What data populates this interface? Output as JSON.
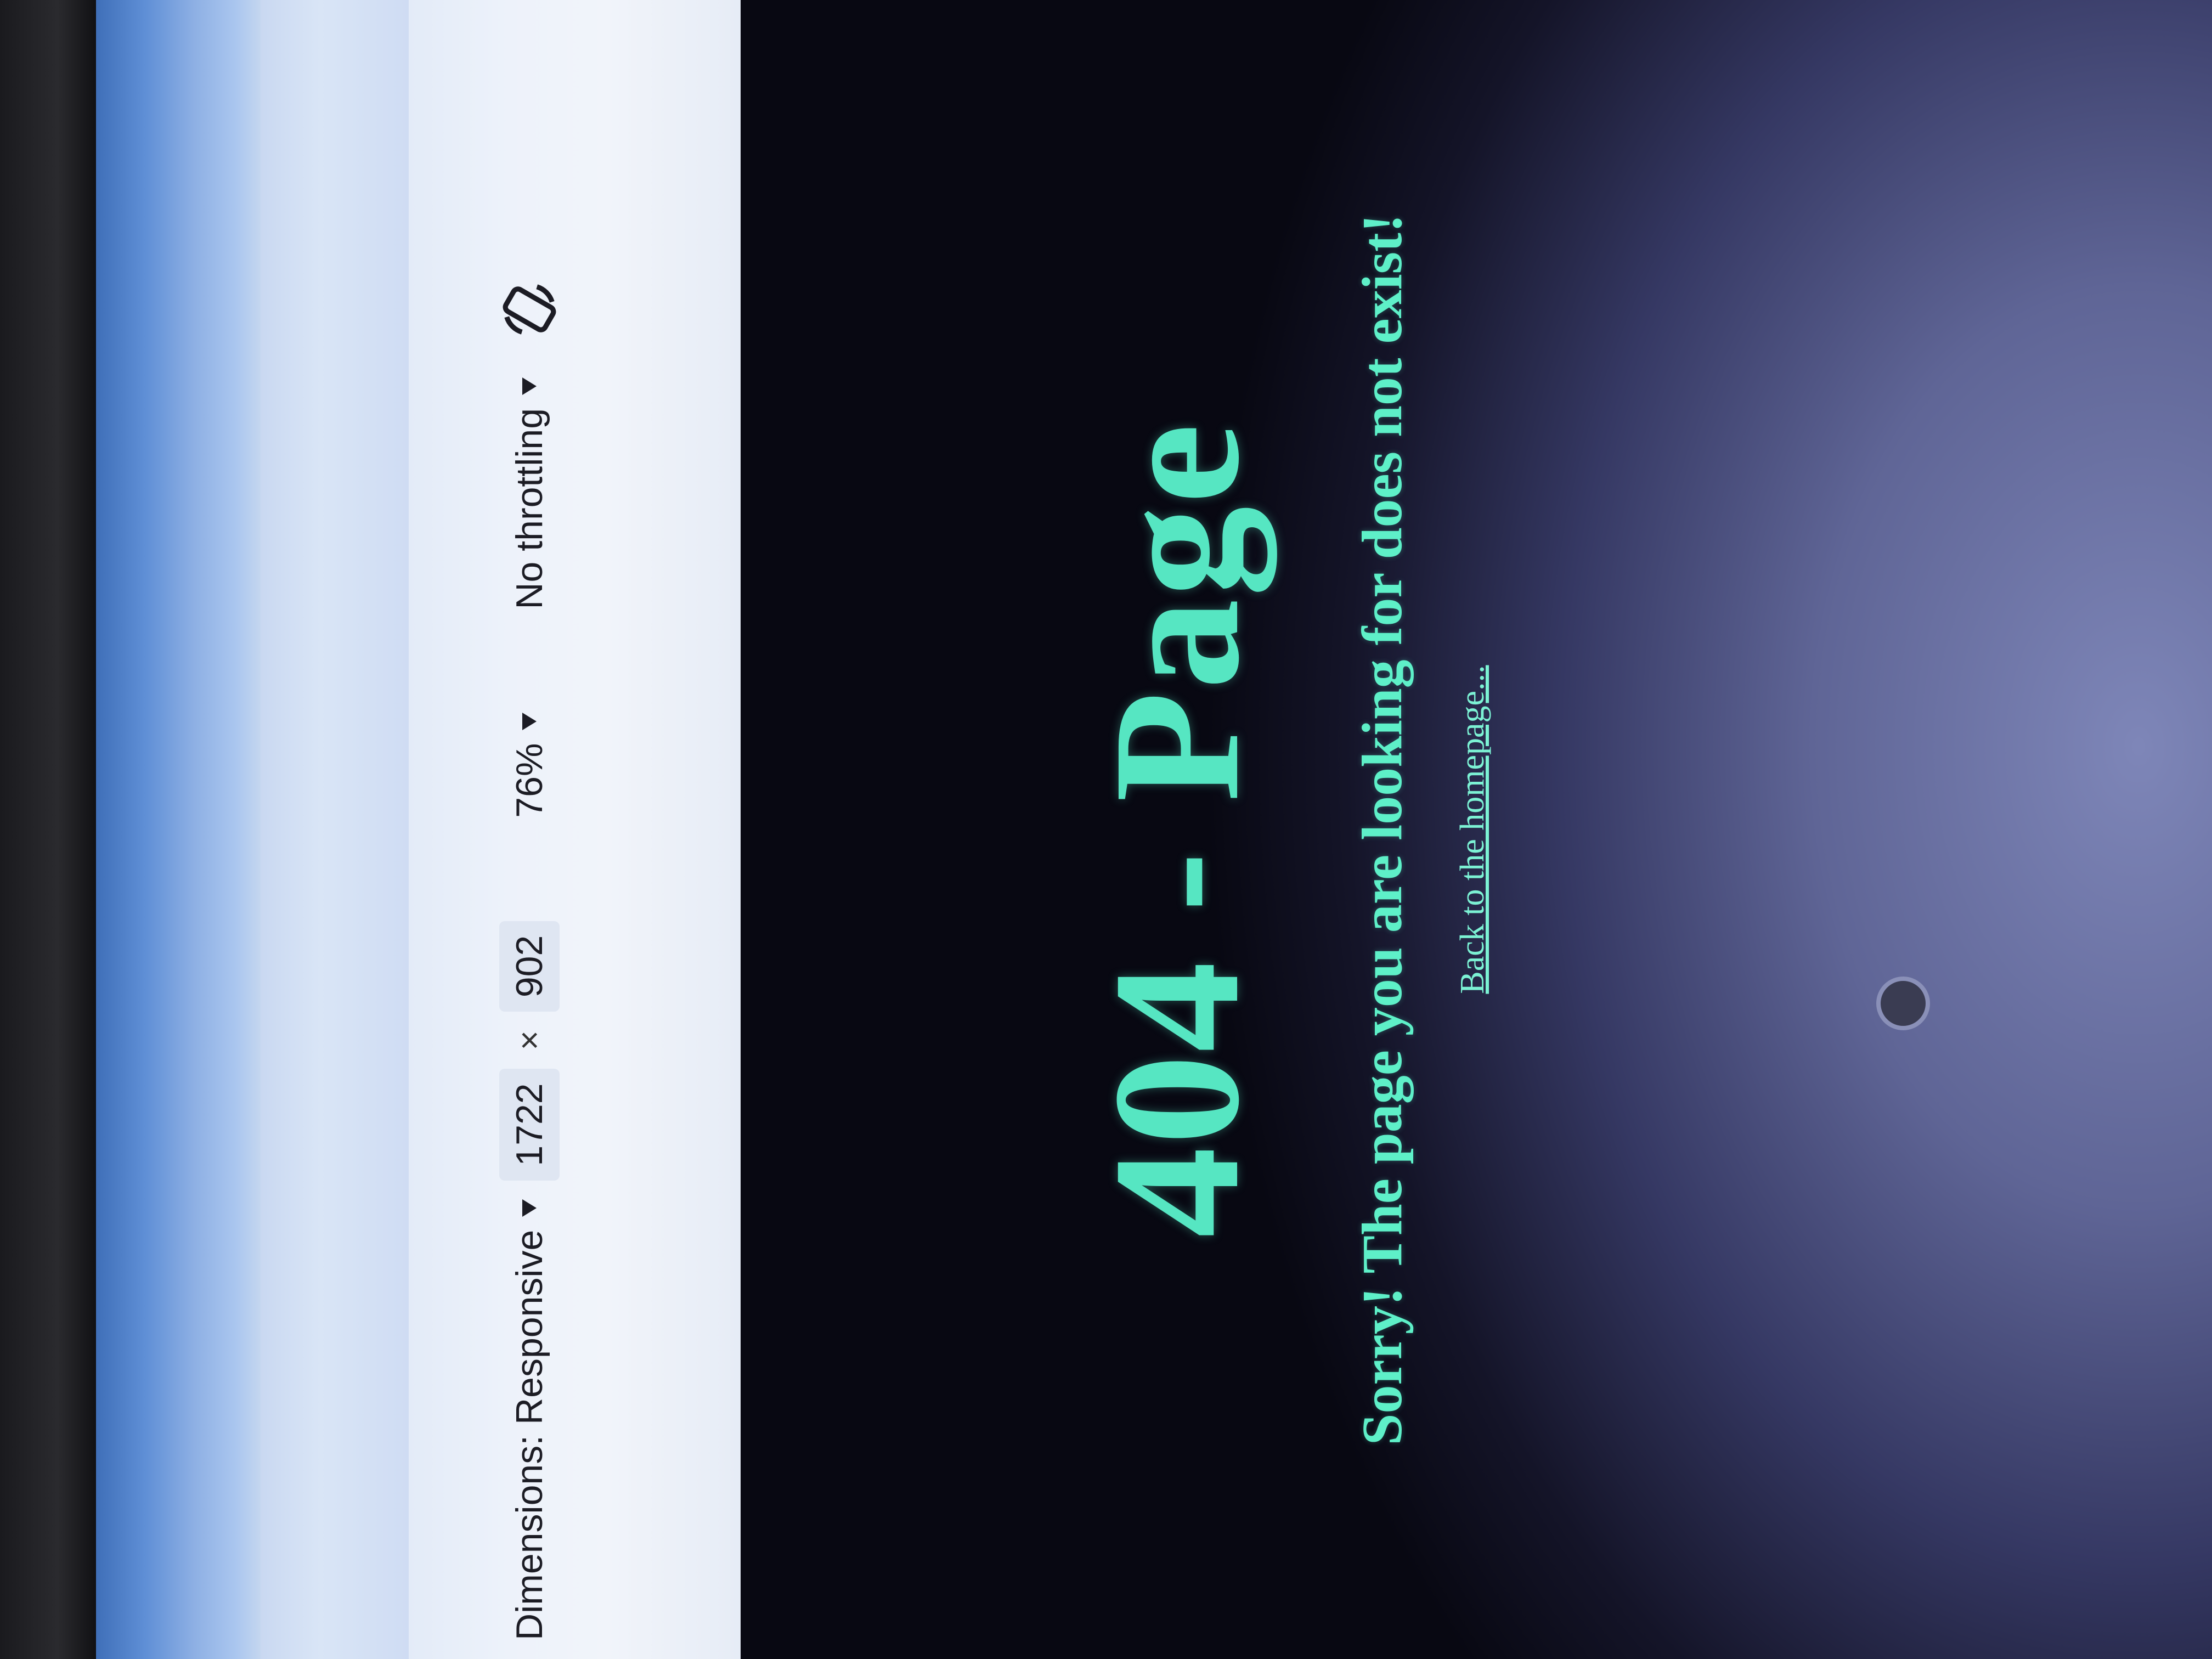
{
  "devtools": {
    "dimensions_label": "Dimensions: Responsive",
    "width_value": "1722",
    "times_sign": "×",
    "height_value": "902",
    "zoom_value": "76%",
    "throttling_value": "No throttling",
    "rotate_icon": "rotate-device-icon"
  },
  "page": {
    "heading": "404 - Page",
    "message": "Sorry! The page you are looking for does not exist!",
    "back_link": "Back to the homepage..."
  },
  "colors": {
    "accent": "#56e6c2",
    "devtools_bg": "#edf2fa",
    "chrome_blue": "#5f8fd6"
  }
}
